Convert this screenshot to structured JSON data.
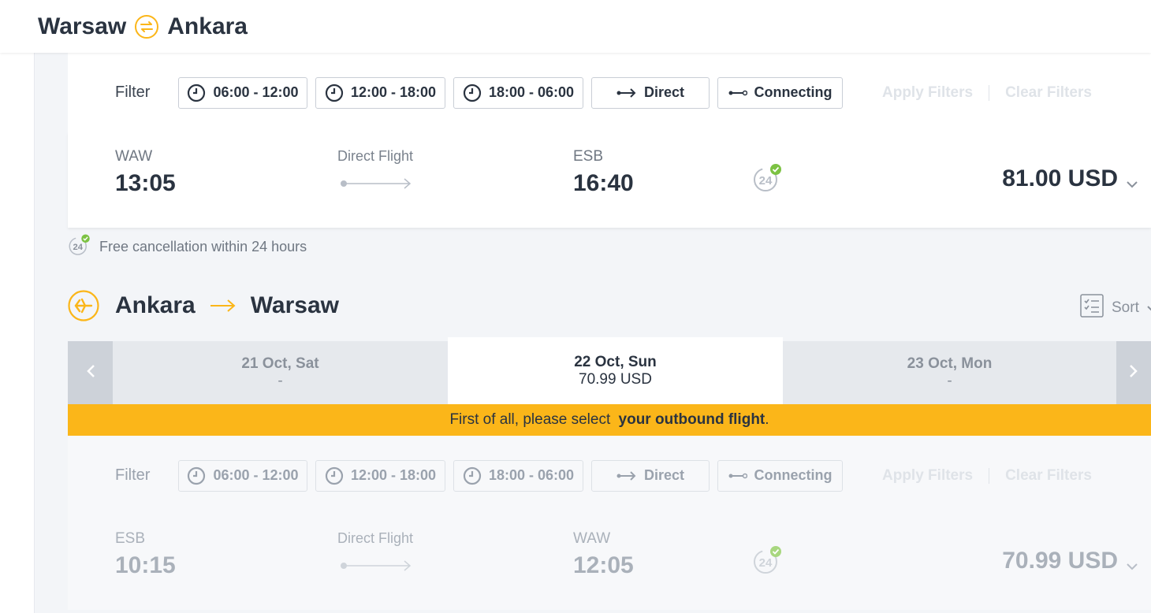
{
  "header": {
    "origin": "Warsaw",
    "destination": "Ankara"
  },
  "filter": {
    "label": "Filter",
    "chips": [
      "06:00 - 12:00",
      "12:00 - 18:00",
      "18:00 - 06:00",
      "Direct",
      "Connecting"
    ],
    "apply_label": "Apply Filters",
    "clear_label": "Clear Filters"
  },
  "outbound_flight": {
    "dep_code": "WAW",
    "dep_time": "13:05",
    "type_label": "Direct Flight",
    "arr_code": "ESB",
    "arr_time": "16:40",
    "price": "81.00 USD"
  },
  "free_cancellation": "Free cancellation within 24 hours",
  "return_section": {
    "origin": "Ankara",
    "destination": "Warsaw",
    "sort_label": "Sort",
    "dates": [
      {
        "date": "21 Oct, Sat",
        "price": "-"
      },
      {
        "date": "22 Oct, Sun",
        "price": "70.99 USD"
      },
      {
        "date": "23 Oct, Mon",
        "price": "-"
      }
    ],
    "notice_prefix": "First of all, please select ",
    "notice_bold": "your outbound flight",
    "notice_suffix": "."
  },
  "return_flight": {
    "dep_code": "ESB",
    "dep_time": "10:15",
    "type_label": "Direct Flight",
    "arr_code": "WAW",
    "arr_time": "12:05",
    "price": "70.99 USD"
  },
  "colors": {
    "accent": "#fbb619",
    "text": "#2a3340",
    "badge_green": "#7cc243"
  }
}
